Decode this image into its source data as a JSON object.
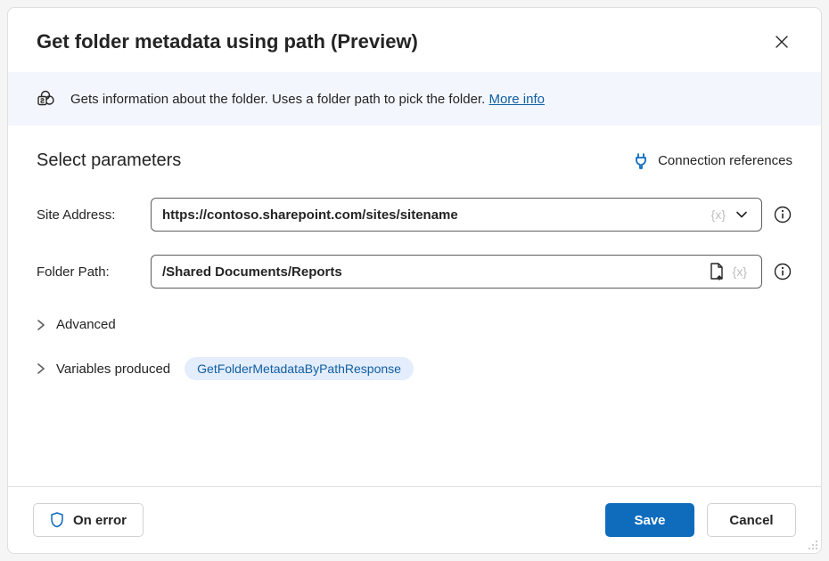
{
  "dialog": {
    "title": "Get folder metadata using path (Preview)"
  },
  "banner": {
    "text": "Gets information about the folder. Uses a folder path to pick the folder. ",
    "moreInfoLabel": "More info"
  },
  "section": {
    "title": "Select parameters",
    "connectionReferencesLabel": "Connection references"
  },
  "params": {
    "siteAddress": {
      "label": "Site Address:",
      "value": "https://contoso.sharepoint.com/sites/sitename",
      "tokenHint": "{x}"
    },
    "folderPath": {
      "label": "Folder Path:",
      "value": "/Shared Documents/Reports",
      "tokenHint": "{x}"
    }
  },
  "expanders": {
    "advanced": {
      "label": "Advanced"
    },
    "variablesProduced": {
      "label": "Variables produced",
      "chip": "GetFolderMetadataByPathResponse"
    }
  },
  "footer": {
    "onErrorLabel": "On error",
    "saveLabel": "Save",
    "cancelLabel": "Cancel"
  },
  "colors": {
    "primary": "#0f6cbd",
    "link": "#115ea3",
    "bannerBg": "#f3f7fd",
    "chipBg": "#e3edfb"
  }
}
